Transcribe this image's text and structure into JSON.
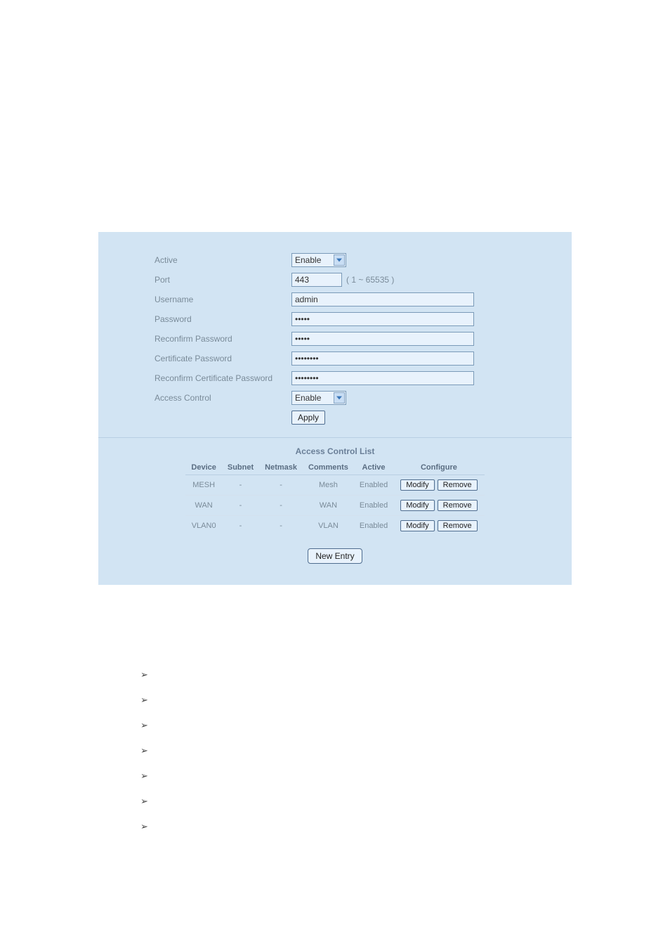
{
  "form": {
    "labels": {
      "active": "Active",
      "port": "Port",
      "username": "Username",
      "password": "Password",
      "reconfirm_password": "Reconfirm Password",
      "certificate_password": "Certificate Password",
      "reconfirm_certificate_password": "Reconfirm Certificate Password",
      "access_control": "Access Control"
    },
    "values": {
      "active": "Enable",
      "port": "443",
      "port_hint": "( 1 ~ 65535 )",
      "username": "admin",
      "password": "•••••",
      "reconfirm_password": "•••••",
      "certificate_password": "••••••••",
      "reconfirm_certificate_password": "••••••••",
      "access_control": "Enable"
    },
    "buttons": {
      "apply": "Apply",
      "new_entry": "New Entry",
      "modify": "Modify",
      "remove": "Remove"
    }
  },
  "acl": {
    "title": "Access Control List",
    "headers": {
      "device": "Device",
      "subnet": "Subnet",
      "netmask": "Netmask",
      "comments": "Comments",
      "active": "Active",
      "configure": "Configure"
    },
    "rows": [
      {
        "device": "MESH",
        "subnet": "-",
        "netmask": "-",
        "comments": "Mesh",
        "active": "Enabled"
      },
      {
        "device": "WAN",
        "subnet": "-",
        "netmask": "-",
        "comments": "WAN",
        "active": "Enabled"
      },
      {
        "device": "VLAN0",
        "subnet": "-",
        "netmask": "-",
        "comments": "VLAN",
        "active": "Enabled"
      }
    ]
  },
  "bullets": [
    "",
    "",
    "",
    "",
    "",
    "",
    ""
  ]
}
